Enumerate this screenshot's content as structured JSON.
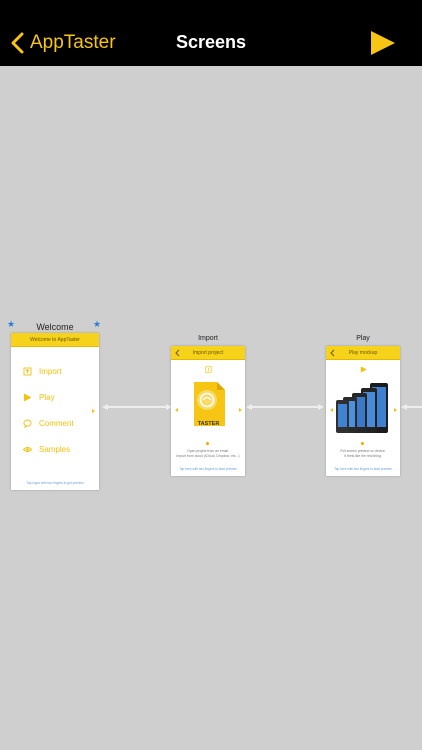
{
  "nav": {
    "back_label": "AppTaster",
    "title": "Screens"
  },
  "screens": [
    {
      "label": "Welcome",
      "header": "Welcome to AppTaster",
      "menu": [
        "Import",
        "Play",
        "Comment",
        "Samples"
      ],
      "footer": "Tap logos with two fingers to get preview"
    },
    {
      "label": "Import",
      "header": "Import project",
      "icon_text": "TASTER",
      "description": [
        "Open project from an email.",
        "Import from cloud (iCloud, Dropbox, etc...)"
      ],
      "footer": "Tap here with two fingers to start preview"
    },
    {
      "label": "Play",
      "header": "Play mockup",
      "description": [
        "Full screen preview on device.",
        "It feels like the real thing."
      ],
      "footer": "Tap here with two fingers to start preview"
    }
  ],
  "colors": {
    "accent": "#f7c614",
    "nav_bg": "#000000",
    "canvas_bg": "#cfcfcf",
    "star": "#2b7fd3"
  }
}
